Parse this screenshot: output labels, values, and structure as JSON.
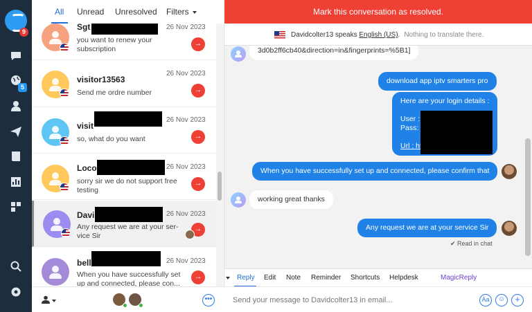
{
  "rail": {
    "badge_notifications": "9",
    "badge_globe": "5",
    "icons": [
      "logo-icon",
      "chat-icon",
      "globe-icon",
      "person-icon",
      "send-icon",
      "book-icon",
      "chart-icon",
      "apps-icon",
      "search-icon",
      "settings-icon"
    ]
  },
  "tabs": {
    "all": "All",
    "unread": "Unread",
    "unresolved": "Unresolved",
    "filters": "Filters"
  },
  "conversations": [
    {
      "name": "Sgt",
      "date": "26 Nov 2023",
      "message": "you want to renew your subscription",
      "avatar_color": "#f7a27e"
    },
    {
      "name": "visitor13563",
      "date": "26 Nov 2023",
      "message": "Send me ordre number",
      "avatar_color": "#ffc85a"
    },
    {
      "name": "visit",
      "date": "26 Nov 2023",
      "message": "so, what do you want",
      "avatar_color": "#5fc5f4"
    },
    {
      "name": "Locog",
      "date": "26 Nov 2023",
      "message": "sorry sir we do not support free testing",
      "avatar_color": "#ffc85a"
    },
    {
      "name": "Davi",
      "date": "26 Nov 2023",
      "message": "Any request we are at your ser-vice Sir",
      "avatar_color": "#9b8cf0"
    },
    {
      "name": "bell",
      "date": "26 Nov 2023",
      "message": "When you have successfully set up and connected, please con...",
      "avatar_color": "#a48bd9"
    }
  ],
  "chat": {
    "resolve_banner": "Mark this conversation as resolved.",
    "lang_user": "Davidcolter13 speaks ",
    "lang_name": "English (US)",
    "lang_suffix": ".",
    "lang_note": "Nothing to translate there.",
    "messages": [
      {
        "dir": "in",
        "text": "3d0b2ff6cb40&direction=in&fingerprints=%5B1]"
      },
      {
        "dir": "out",
        "text": "download app iptv smarters pro"
      },
      {
        "dir": "out",
        "lines": [
          "Here are your login details :",
          "",
          "User :",
          "Pass: 3",
          "",
          "Url : ht"
        ]
      },
      {
        "dir": "out",
        "text": "When you have successfully set up and connected, please confirm that"
      },
      {
        "dir": "in",
        "text": "working great thanks"
      },
      {
        "dir": "out",
        "text": "Any request we are at your service Sir"
      }
    ],
    "read_status": "✔ Read in chat"
  },
  "compose": {
    "tabs": [
      "Reply",
      "Edit",
      "Note",
      "Reminder",
      "Shortcuts",
      "Helpdesk"
    ],
    "magic": "MagicReply",
    "placeholder": "Send your message to Davidcolter13 in email...",
    "aa_label": "Aa"
  },
  "colors": {
    "accent": "#1e6fd9",
    "danger": "#ee4035",
    "rail": "#1e2d3d",
    "bubble_out": "#2082e6"
  }
}
